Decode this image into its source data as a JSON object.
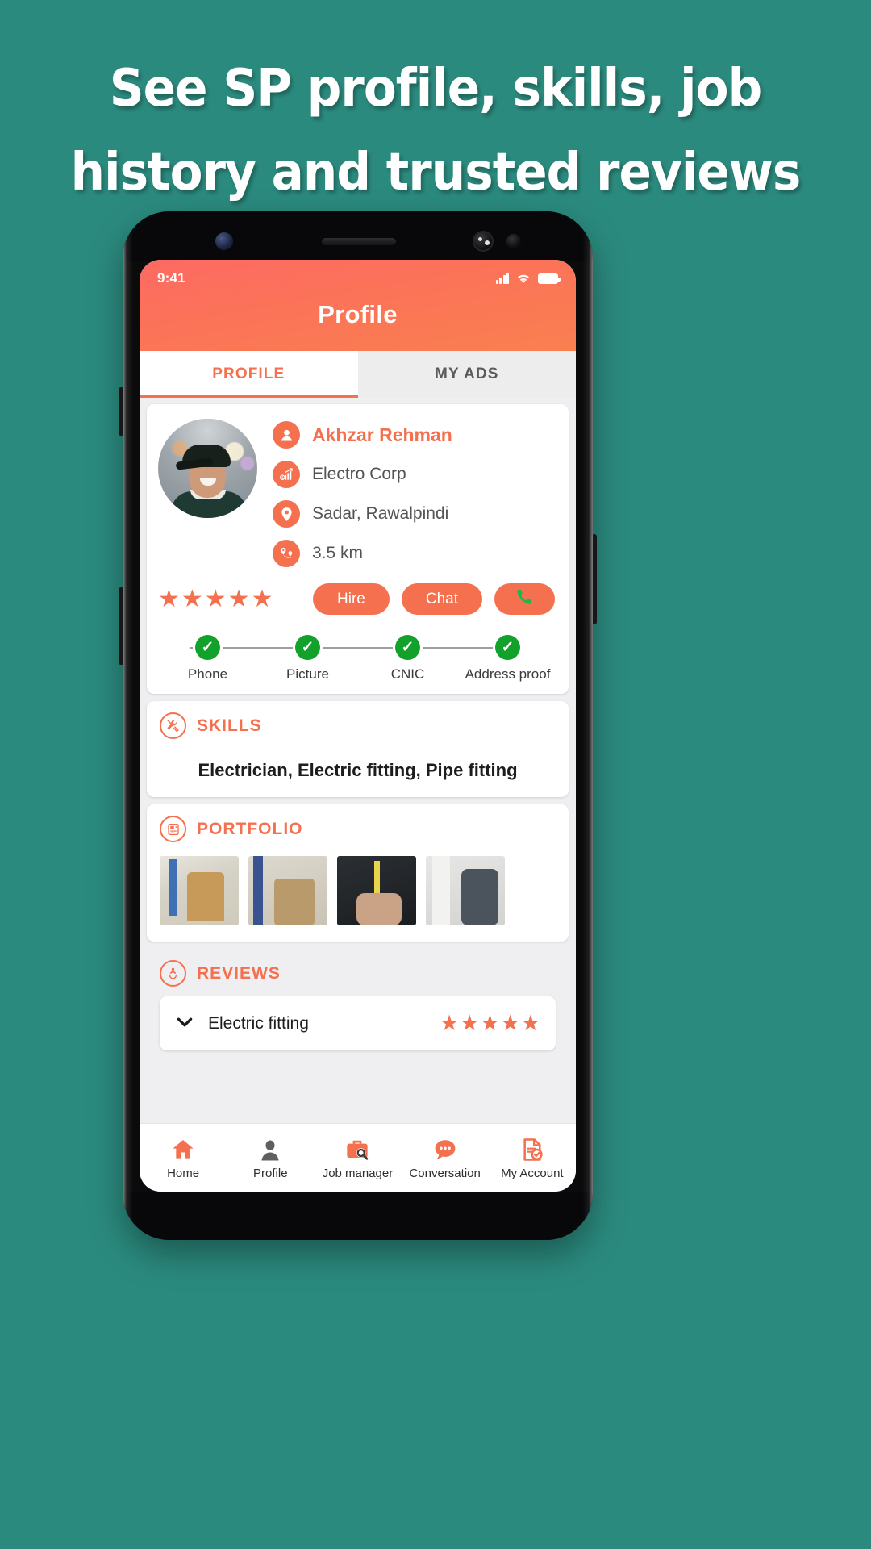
{
  "headline": {
    "line1": "See SP profile, skills, job",
    "line2": "history and trusted reviews"
  },
  "colors": {
    "background": "#2b8a7e",
    "accent": "#f4704f",
    "header_gradient_start": "#fc6a63",
    "header_gradient_end": "#fa8050",
    "verified_green": "#12a22b",
    "call_green": "#19b84a"
  },
  "status_bar": {
    "time": "9:41",
    "icons": [
      "signal-icon",
      "wifi-icon",
      "battery-icon"
    ]
  },
  "header": {
    "title": "Profile"
  },
  "tabs": [
    {
      "label": "PROFILE",
      "active": true
    },
    {
      "label": "MY ADS",
      "active": false
    }
  ],
  "profile": {
    "avatar_alt": "profile-photo",
    "rows": [
      {
        "icon": "person-icon",
        "text": "Akhzar Rehman",
        "emphasis": true
      },
      {
        "icon": "business-icon",
        "text": "Electro Corp",
        "emphasis": false
      },
      {
        "icon": "location-icon",
        "text": "Sadar, Rawalpindi",
        "emphasis": false
      },
      {
        "icon": "route-icon",
        "text": "3.5 km",
        "emphasis": false
      }
    ],
    "rating_stars": "★★★★★",
    "actions": {
      "hire": "Hire",
      "chat": "Chat",
      "call_icon": "phone-icon"
    },
    "verification": [
      {
        "label": "Phone",
        "checked": true,
        "mark": "✓"
      },
      {
        "label": "Picture",
        "checked": true,
        "mark": "✓"
      },
      {
        "label": "CNIC",
        "checked": true,
        "mark": "✓"
      },
      {
        "label": "Address proof",
        "checked": true,
        "mark": "✓"
      }
    ]
  },
  "skills": {
    "icon": "tools-icon",
    "title": "SKILLS",
    "value": "Electrician, Electric fitting, Pipe fitting"
  },
  "portfolio": {
    "icon": "portfolio-icon",
    "title": "PORTFOLIO",
    "thumbnails": [
      "electrician-site-photo-1",
      "electrician-toolbelt-photo-2",
      "electrician-wires-photo-3",
      "electrician-panel-photo-4"
    ]
  },
  "reviews": {
    "icon": "reviews-icon",
    "title": "REVIEWS",
    "items": [
      {
        "chevron": "⌄",
        "title": "Electric fitting",
        "stars": "★★★★★"
      }
    ]
  },
  "bottom_nav": [
    {
      "icon": "home-icon",
      "label": "Home"
    },
    {
      "icon": "profile-icon",
      "label": "Profile"
    },
    {
      "icon": "job-manager-icon",
      "label": "Job manager"
    },
    {
      "icon": "conversation-icon",
      "label": "Conversation"
    },
    {
      "icon": "my-account-icon",
      "label": "My Account"
    }
  ]
}
